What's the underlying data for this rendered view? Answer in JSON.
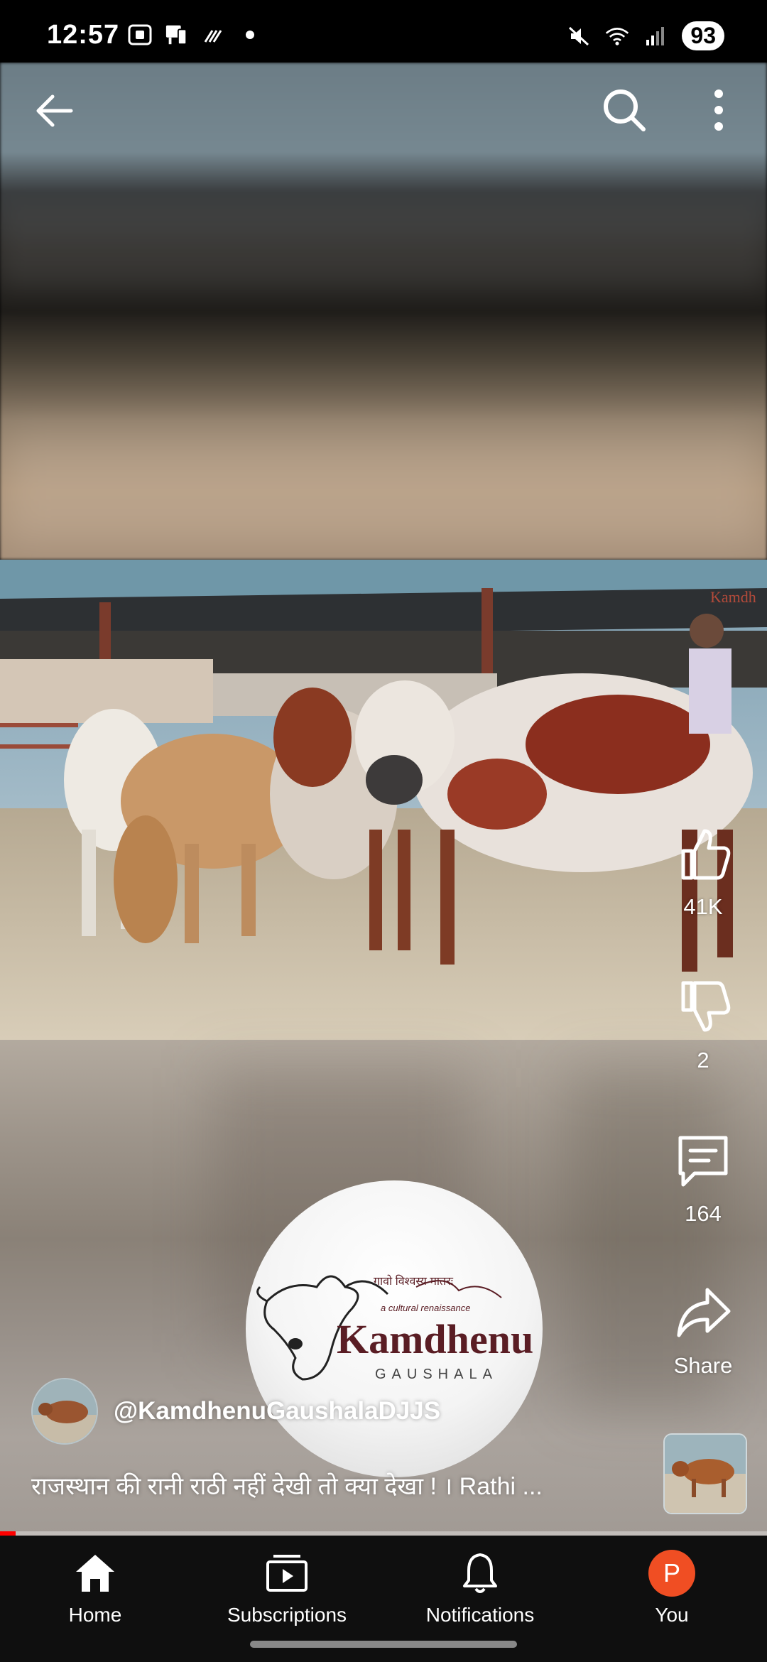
{
  "status_bar": {
    "time": "12:57",
    "battery": "93",
    "icons_left": [
      "screenshot-icon",
      "device-icon",
      "signal-strength-icon",
      "dot-icon"
    ],
    "icons_right": [
      "mute-icon",
      "wifi-icon",
      "cellular-icon"
    ]
  },
  "video": {
    "likes": "41K",
    "dislikes": "2",
    "comments": "164",
    "share_label": "Share",
    "channel_handle": "@KamdhenuGaushalaDJJS",
    "title": "राजस्थान की रानी राठी नहीं देखी तो क्या देखा ! । Rathi  ...",
    "logo": {
      "main": "Kamdhenu",
      "sub": "GAUSHALA",
      "tagline": "a cultural renaissance",
      "hindi": "गावो विश्वस्य मातरः"
    },
    "progress_fraction": 0.02
  },
  "bottom_nav": {
    "home": "Home",
    "subscriptions": "Subscriptions",
    "notifications": "Notifications",
    "you": "You",
    "you_initial": "P"
  },
  "colors": {
    "progress": "#ff0000",
    "you_avatar": "#f04e23",
    "nav_bg": "#0f0f0f"
  }
}
